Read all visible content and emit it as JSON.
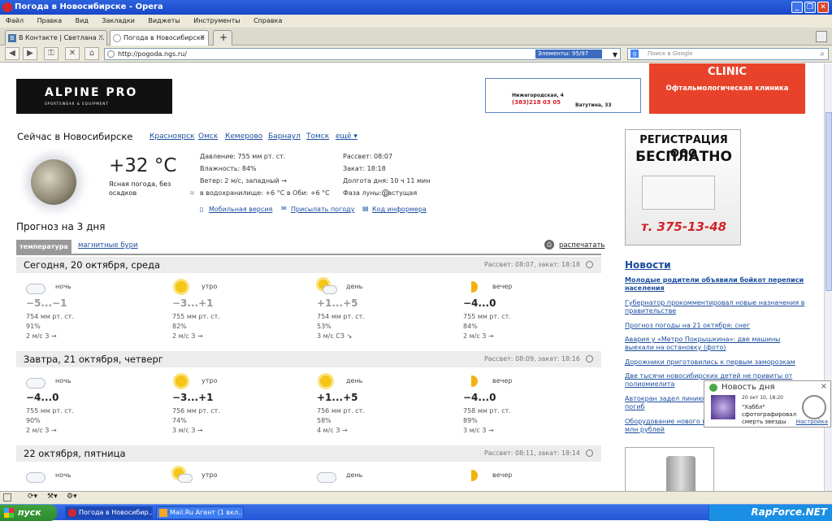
{
  "window": {
    "title": "Погода в Новосибирске - Opera"
  },
  "menu": [
    "Файл",
    "Правка",
    "Вид",
    "Закладки",
    "Виджеты",
    "Инструменты",
    "Справка"
  ],
  "tabs": [
    {
      "label": "В Контакте | Светлана ..."
    },
    {
      "label": "Погода в Новосибирске"
    }
  ],
  "nav": {
    "url": "http://pogoda.ngs.ru/",
    "elements": "Элементы:   95/97",
    "search_placeholder": "Поиск в Google"
  },
  "ads": {
    "alpine_logo": "ALPINE PRO",
    "alpine_sub": "SPORTSWEAR & EQUIPMENT",
    "banner2_address": "Нижегородская, 4",
    "banner2_phone": "(383)218 03 05",
    "banner2_address2": "Ватутина, 33",
    "clinic_name": "CLINIC",
    "clinic_desc": "Офтальмологическая клиника",
    "reg_line1": "РЕГИСТРАЦИЯ ООО",
    "reg_line2": "БЕСПЛАТНО",
    "reg_phone": "т. 375-13-48"
  },
  "current": {
    "title": "Сейчас в Новосибирске",
    "cities": [
      "Красноярск",
      "Омск",
      "Кемерово",
      "Барнаул",
      "Томск",
      "ещё ▾"
    ],
    "temp": "+32 °C",
    "desc": "Ясная погода, без осадков",
    "pressure": "Давление: 755 мм рт. ст.",
    "humidity": "Влажность: 84%",
    "wind": "Ветер: 2 м/с, западный →",
    "water": "в водохранилище: +6 °C  в Оби: +6 °C",
    "sunrise": "Рассвет: 08:07",
    "sunset": "Закат: 18:18",
    "daylength": "Долгота дня: 10 ч 11 мин",
    "moonphase": "Фаза луны:   растущая",
    "links": [
      "Мобильная версия",
      "Присылать погоду",
      "Код информера"
    ]
  },
  "forecast": {
    "title": "Прогноз на 3 дня",
    "tab_temp": "температура",
    "tab_storm": "магнитные бури",
    "print": "распечатать",
    "days": [
      {
        "name": "Сегодня, 20 октября, среда",
        "sun": "Рассвет: 08:07, закат: 18:18",
        "periods": [
          {
            "label": "ночь",
            "icon": "cloud",
            "temp": "−5...−1",
            "past": true,
            "pressure": "754 мм рт. ст.",
            "humidity": "91%",
            "wind": "2 м/с  З →"
          },
          {
            "label": "утро",
            "icon": "sun",
            "temp": "−3...+1",
            "past": true,
            "pressure": "755 мм рт. ст.",
            "humidity": "82%",
            "wind": "2 м/с  З →"
          },
          {
            "label": "день",
            "icon": "sun-cloud",
            "temp": "+1...+5",
            "past": true,
            "pressure": "754 мм рт. ст.",
            "humidity": "53%",
            "wind": "3 м/с  СЗ ↘"
          },
          {
            "label": "вечер",
            "icon": "moon",
            "temp": "−4...0",
            "past": false,
            "pressure": "755 мм рт. ст.",
            "humidity": "84%",
            "wind": "2 м/с  З →"
          }
        ]
      },
      {
        "name": "Завтра, 21 октября, четверг",
        "sun": "Рассвет: 08:09, закат: 18:16",
        "periods": [
          {
            "label": "ночь",
            "icon": "cloud",
            "temp": "−4...0",
            "past": false,
            "pressure": "755 мм рт. ст.",
            "humidity": "90%",
            "wind": "2 м/с  З →"
          },
          {
            "label": "утро",
            "icon": "sun",
            "temp": "−3...+1",
            "past": false,
            "pressure": "756 мм рт. ст.",
            "humidity": "74%",
            "wind": "3 м/с  З →"
          },
          {
            "label": "день",
            "icon": "sun",
            "temp": "+1...+5",
            "past": false,
            "pressure": "756 мм рт. ст.",
            "humidity": "58%",
            "wind": "4 м/с  З →"
          },
          {
            "label": "вечер",
            "icon": "moon",
            "temp": "−4...0",
            "past": false,
            "pressure": "758 мм рт. ст.",
            "humidity": "89%",
            "wind": "3 м/с  З →"
          }
        ]
      },
      {
        "name": "22 октября, пятница",
        "sun": "Рассвет: 08:11, закат: 18:14",
        "periods": [
          {
            "label": "ночь",
            "icon": "cloud"
          },
          {
            "label": "утро",
            "icon": "sun-cloud"
          },
          {
            "label": "день",
            "icon": "cloud"
          },
          {
            "label": "вечер",
            "icon": "moon"
          }
        ]
      }
    ]
  },
  "news": {
    "title": "Новости",
    "items": [
      "Молодые родители объявили бойкот переписи населения",
      "Губернатор прокомментировал новые назначения в правительстве",
      "Прогноз погоды на 21 октября: снег",
      "Авария у «Метро Покрышкина»: две машины выехали на остановку (фото)",
      "Дорожники приготовились к первым заморозкам",
      "Две тысячи новосибирских детей не привиты от полиомиелита",
      "Автокран задел линию электропередачи: машинист погиб",
      "Оборудование нового планетария обойдётся в 60 млн рублей"
    ]
  },
  "popup": {
    "title": "Новость дня",
    "date": "20 окт 10, 18:20",
    "text": "\"Хаббл\" сфотографировал смерть звезды",
    "settings": "Настройка"
  },
  "taskbar": {
    "start": "пуск",
    "items": [
      "Погода в Новосибир...",
      "Mail.Ru Агент (1 вкл..."
    ],
    "brand": "RapForce.NET"
  }
}
